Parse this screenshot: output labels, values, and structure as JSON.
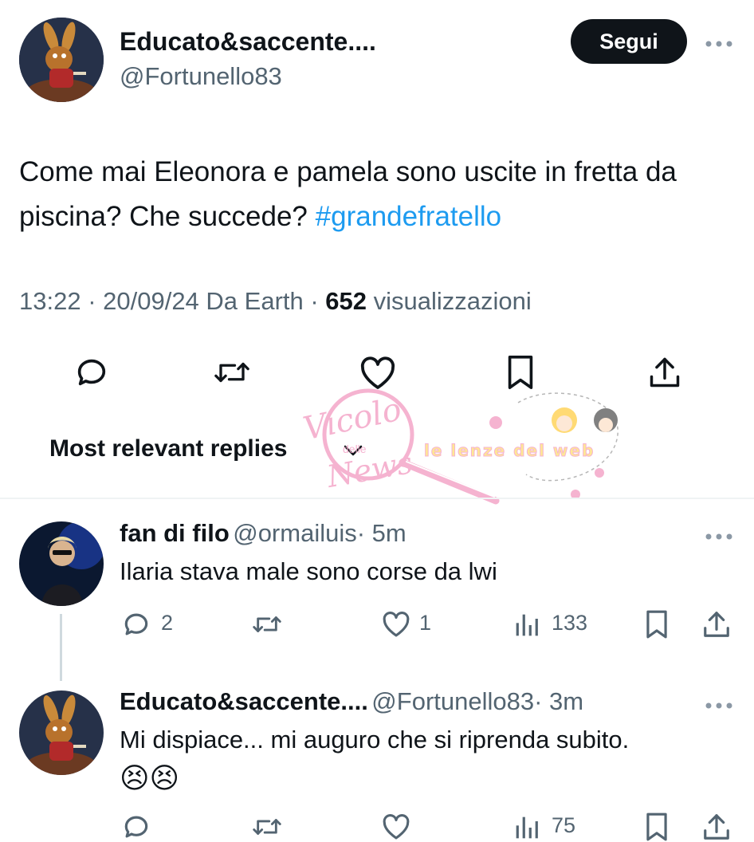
{
  "tweet": {
    "author_name": "Educato&saccente....",
    "author_handle": "@Fortunello83",
    "follow_label": "Segui",
    "text": "Come mai Eleonora e pamela sono uscite in fretta da piscina? Che succede?",
    "hashtag": "#grandefratello",
    "time_date_source": "13:22 · 20/09/24 Da Earth · ",
    "views_count": "652",
    "views_label": " visualizzazioni"
  },
  "replies_header": {
    "label": "Most relevant replies"
  },
  "watermark": {
    "script_text": "Vicolo",
    "script_text_2": "News",
    "small_text": "delle",
    "banner_text": "le lenze del web"
  },
  "replies": [
    {
      "author_name": "fan di filo",
      "author_handle": "@ormailuis",
      "time": "· 5m",
      "text": "Ilaria stava male sono corse da lwi",
      "reply_count": "2",
      "like_count": "1",
      "views_count": "133"
    },
    {
      "author_name": "Educato&saccente....",
      "author_handle": "@Fortunello83",
      "time": "· 3m",
      "text": "Mi dispiace... mi auguro che si riprenda subito.",
      "emoji": "😣😣",
      "views_count": "75"
    }
  ],
  "colors": {
    "accent": "#1d9bf0",
    "text_primary": "#0f1419",
    "text_secondary": "#536471",
    "divider": "#eff3f4",
    "watermark_pink": "#f4a6c8"
  },
  "icons": [
    "reply-icon",
    "retweet-icon",
    "like-icon",
    "bookmark-icon",
    "share-icon",
    "views-icon",
    "more-icon",
    "chevron-down-icon"
  ]
}
